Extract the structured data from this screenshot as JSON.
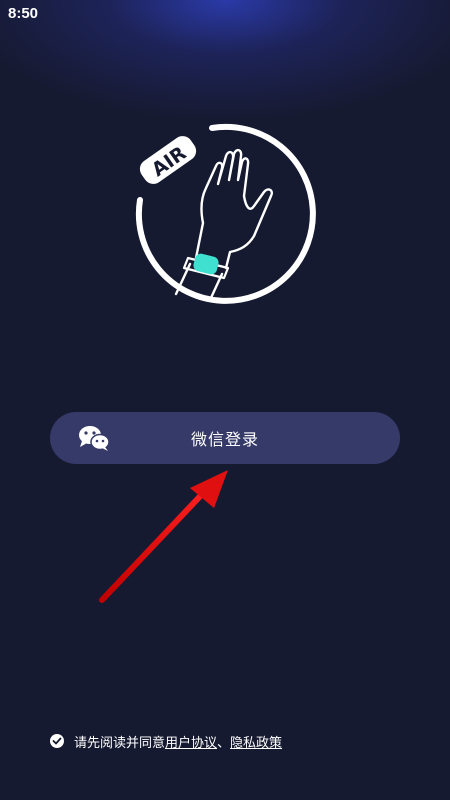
{
  "status_bar": {
    "time": "8:50"
  },
  "logo": {
    "badge_text": "AIR",
    "icon": "hand-with-wristband-icon"
  },
  "login": {
    "label": "微信登录",
    "icon": "wechat-icon"
  },
  "agreement": {
    "prefix": "请先阅读并同意",
    "user_agreement": "用户协议",
    "separator": "、",
    "privacy_policy": "隐私政策",
    "checked": true
  },
  "colors": {
    "background": "#161a31",
    "button": "#363a69",
    "band": "#3fe0d0",
    "arrow": "#e01010"
  }
}
